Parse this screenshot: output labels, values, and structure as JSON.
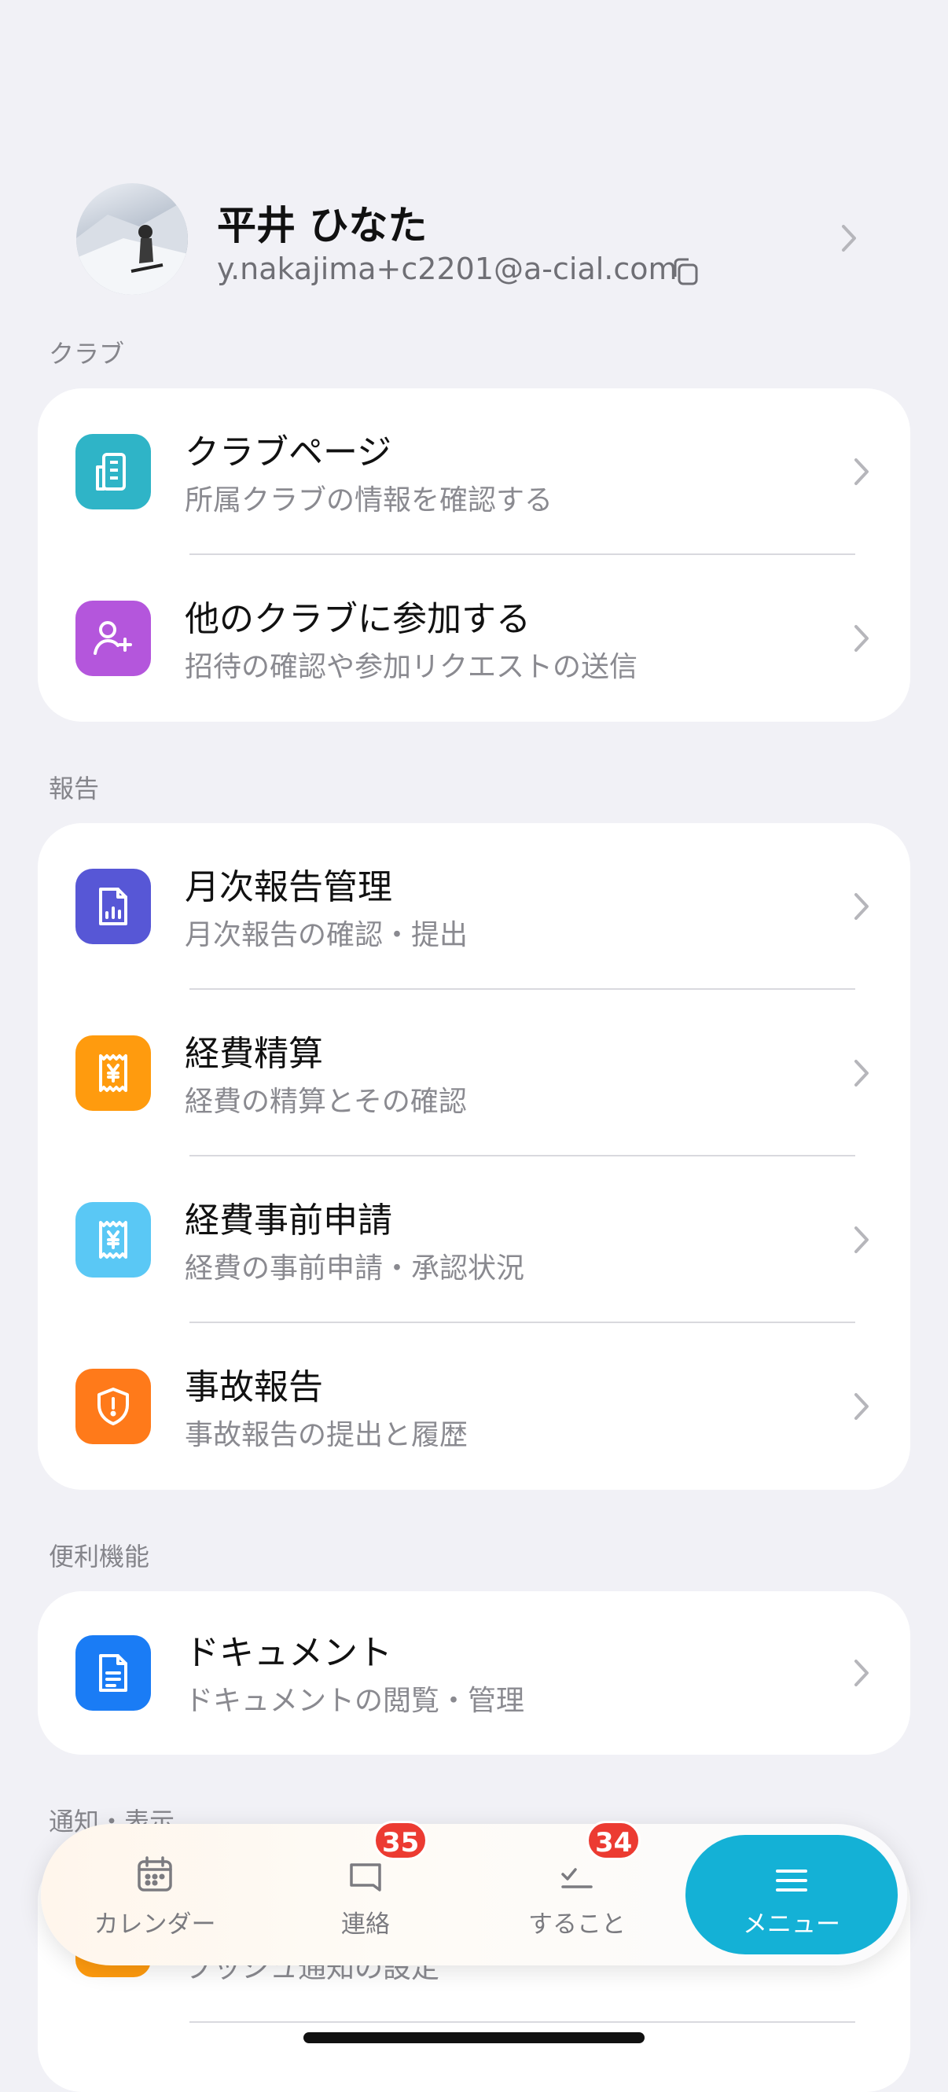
{
  "profile": {
    "name": "平井 ひなた",
    "email": "y.nakajima+c2201@a-cial.com"
  },
  "sections": {
    "club": {
      "label": "クラブ",
      "items": [
        {
          "title": "クラブページ",
          "subtitle": "所属クラブの情報を確認する",
          "icon": "building-icon",
          "color": "#2fb4c7"
        },
        {
          "title": "他のクラブに参加する",
          "subtitle": "招待の確認や参加リクエストの送信",
          "icon": "user-plus-icon",
          "color": "#b456dc"
        }
      ]
    },
    "report": {
      "label": "報告",
      "items": [
        {
          "title": "月次報告管理",
          "subtitle": "月次報告の確認・提出",
          "icon": "report-chart-icon",
          "color": "#5757d6"
        },
        {
          "title": "経費精算",
          "subtitle": "経費の精算とその確認",
          "icon": "yen-receipt-icon",
          "color": "#ff9b0e"
        },
        {
          "title": "経費事前申請",
          "subtitle": "経費の事前申請・承認状況",
          "icon": "yen-receipt-icon",
          "color": "#5ac8f5"
        },
        {
          "title": "事故報告",
          "subtitle": "事故報告の提出と履歴",
          "icon": "shield-alert-icon",
          "color": "#ff7a1a"
        }
      ]
    },
    "convenience": {
      "label": "便利機能",
      "items": [
        {
          "title": "ドキュメント",
          "subtitle": "ドキュメントの閲覧・管理",
          "icon": "document-icon",
          "color": "#1a7cf5"
        }
      ]
    },
    "notify": {
      "label": "通知・表示",
      "items": [
        {
          "title": "",
          "subtitle": "プッシュ通知の設定",
          "icon": "bell-icon",
          "color": "#ff9b0e"
        }
      ]
    }
  },
  "tabbar": {
    "calendar": {
      "label": "カレンダー"
    },
    "contact": {
      "label": "連絡",
      "badge": "35"
    },
    "todo": {
      "label": "すること",
      "badge": "34"
    },
    "menu": {
      "label": "メニュー"
    }
  }
}
